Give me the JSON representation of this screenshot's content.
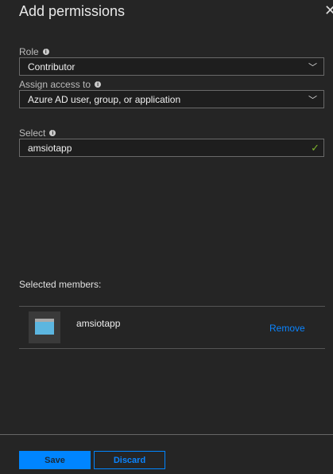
{
  "header": {
    "title": "Add permissions",
    "close_icon": "close-icon"
  },
  "form": {
    "role": {
      "label": "Role",
      "value": "Contributor"
    },
    "assign": {
      "label": "Assign access to",
      "value": "Azure AD user, group, or application"
    },
    "select": {
      "label": "Select",
      "value": "amsiotapp"
    }
  },
  "members": {
    "heading": "Selected members:",
    "items": [
      {
        "name": "amsiotapp",
        "remove_label": "Remove"
      }
    ]
  },
  "footer": {
    "save_label": "Save",
    "discard_label": "Discard"
  },
  "colors": {
    "accent": "#0085ff",
    "check": "#7db22c",
    "background": "#252525"
  }
}
